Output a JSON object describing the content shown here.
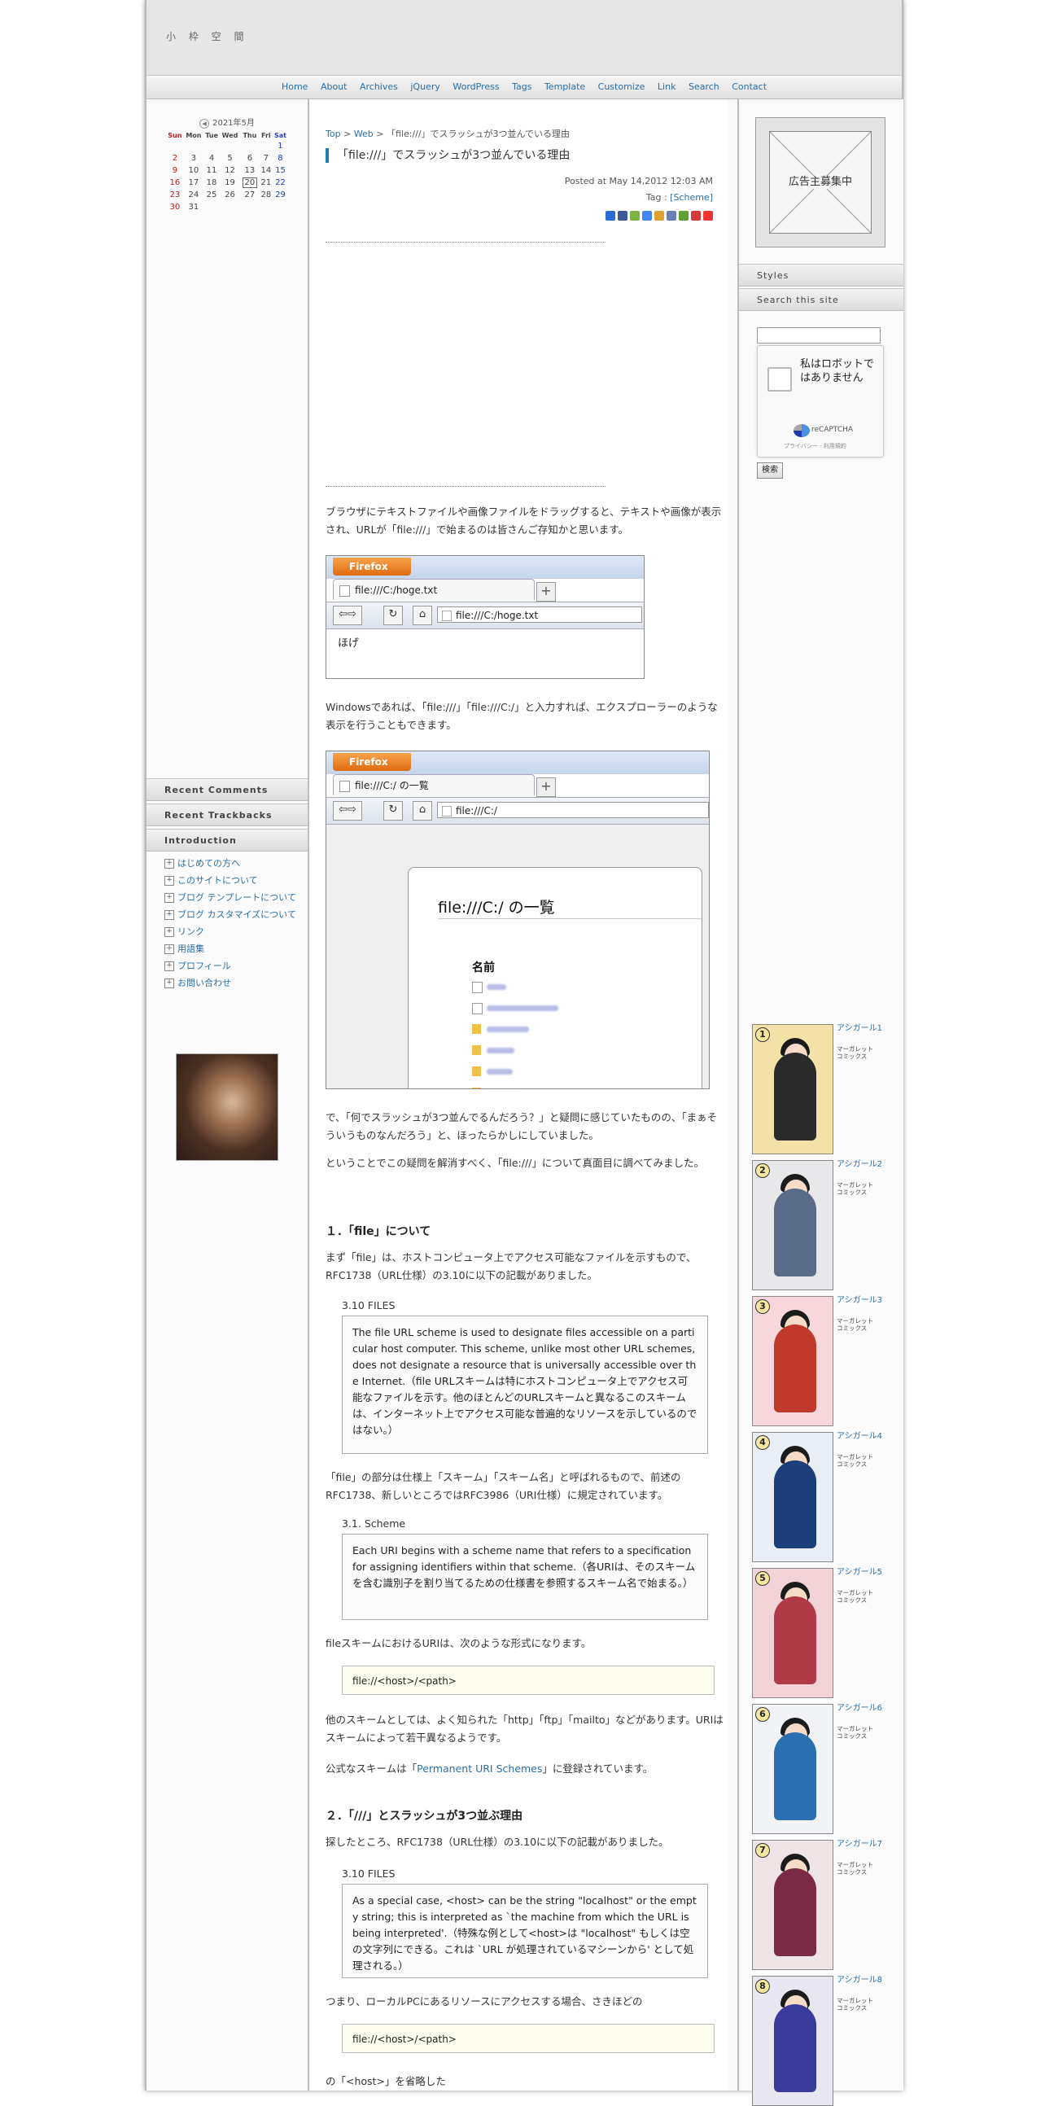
{
  "site": {
    "title": "小 枠 空 間"
  },
  "nav": [
    "Home",
    "About",
    "Archives",
    "jQuery",
    "WordPress",
    "Tags",
    "Template",
    "Customize",
    "Link",
    "Search",
    "Contact"
  ],
  "calendar": {
    "title": "2021年5月",
    "weekdays": [
      "Sun",
      "Mon",
      "Tue",
      "Wed",
      "Thu",
      "Fri",
      "Sat"
    ],
    "weeks": [
      [
        "",
        "",
        "",
        "",
        "",
        "",
        "1"
      ],
      [
        "2",
        "3",
        "4",
        "5",
        "6",
        "7",
        "8"
      ],
      [
        "9",
        "10",
        "11",
        "12",
        "13",
        "14",
        "15"
      ],
      [
        "16",
        "17",
        "18",
        "19",
        "20",
        "21",
        "22"
      ],
      [
        "23",
        "24",
        "25",
        "26",
        "27",
        "28",
        "29"
      ],
      [
        "30",
        "31",
        "",
        "",
        "",
        "",
        ""
      ]
    ],
    "today": "20"
  },
  "left_boxes": [
    "Recent Comments",
    "Recent Trackbacks",
    "Introduction"
  ],
  "intro_links": [
    "はじめての方へ",
    "このサイトについて",
    "ブログ テンプレートについて",
    "ブログ カスタマイズについて",
    "リンク",
    "用語集",
    "プロフィール",
    "お問い合わせ"
  ],
  "post": {
    "breadcrumb": {
      "top": "Top",
      "sep": ">",
      "cat": "Web",
      "current": "「file:///」でスラッシュが3つ並んでいる理由"
    },
    "title": "「file:///」でスラッシュが3つ並んでいる理由",
    "posted": "Posted at May 14,2012 12:03 AM",
    "tag_label": "Tag : ",
    "tag": "[Scheme]",
    "p1": "ブラウザにテキストファイルや画像ファイルをドラッグすると、テキストや画像が表示され、URLが「file:///」で始まるのは皆さんご存知かと思います。",
    "shot1": {
      "menu": "Firefox",
      "tab": "file:///C:/hoge.txt",
      "url": "file:///C:/hoge.txt",
      "body": "ほげ"
    },
    "p2": "Windowsであれば、「file:///」「file:///C:/」と入力すれば、エクスプローラーのような表示を行うこともできます。",
    "shot2": {
      "menu": "Firefox",
      "tab": "file:///C:/ の一覧",
      "url": "file:///C:/",
      "heading": "file:///C:/ の一覧",
      "column": "名前"
    },
    "p3": "で、「何でスラッシュが3つ並んでるんだろう？」と疑問に感じていたものの、「まぁそういうものなんだろう」と、ほったらかしにしていました。",
    "p4": "ということでこの疑問を解消すべく、「file:///」について真面目に調べてみました。",
    "h1": "１．「file」について",
    "p5": "まず「file」は、ホストコンピュータ上でアクセス可能なファイルを示すもので、RFC1738（URL仕様）の3.10に以下の記載がありました。",
    "q1_head": "3.10 FILES",
    "q1": "The file URL scheme is used to designate files accessible on a particular host computer. This scheme, unlike most other URL schemes, does not designate a resource that is universally accessible over the Internet.（file URLスキームは特にホストコンピュータ上でアクセス可能なファイルを示す。他のほとんどのURLスキームと異なるこのスキームは、インターネット上でアクセス可能な普遍的なリソースを示しているのではない。）",
    "p6": "「file」の部分は仕様上「スキーム」「スキーム名」と呼ばれるもので、前述のRFC1738、新しいところではRFC3986（URI仕様）に規定されています。",
    "q2_head": "3.1. Scheme",
    "q2": "Each URI begins with a scheme name that refers to a specification for assigning identifiers within that scheme.（各URIは、そのスキームを含む識別子を割り当てるための仕様書を参照するスキーム名で始まる。）",
    "p7": "fileスキームにおけるURIは、次のような形式になります。",
    "code1": "file://<host>/<path>",
    "p8": "他のスキームとしては、よく知られた「http」「ftp」「mailto」などがあります。URIはスキームによって若干異なるようです。",
    "p9_pre": "公式なスキームは「",
    "p9_link": "Permanent URI Schemes",
    "p9_post": "」に登録されています。",
    "h2": "２．「///」とスラッシュが3つ並ぶ理由",
    "p10": "探したところ、RFC1738（URL仕様）の3.10に以下の記載がありました。",
    "q3_head": "3.10 FILES",
    "q3": "As a special case, <host> can be the string \"localhost\" or the empty string; this is interpreted as `the machine from which the URL is being interpreted'.（特殊な例として<host>は \"localhost\" もしくは空の文字列にできる。これは `URL が処理されているマシーンから' として処理される。）",
    "p11": "つまり、ローカルPCにあるリソースにアクセスする場合、さきほどの",
    "code2": "file://<host>/<path>",
    "p12": "の「<host>」を省略した"
  },
  "right": {
    "ad_text": "広告主募集中",
    "boxes": [
      "Styles",
      "Search this site"
    ],
    "captcha_text": "私はロボットではありません",
    "captcha_brand": "reCAPTCHA",
    "captcha_links": "プライバシー - 利用規約",
    "search_button": "検索",
    "books": [
      {
        "num": "1",
        "title": "アシガール1",
        "sub": "マーガレットコミックス"
      },
      {
        "num": "2",
        "title": "アシガール2",
        "sub": "マーガレットコミックス"
      },
      {
        "num": "3",
        "title": "アシガール3",
        "sub": "マーガレットコミックス"
      },
      {
        "num": "4",
        "title": "アシガール4",
        "sub": "マーガレットコミックス"
      },
      {
        "num": "5",
        "title": "アシガール5",
        "sub": "マーガレットコミックス"
      },
      {
        "num": "6",
        "title": "アシガール6",
        "sub": "マーガレットコミックス"
      },
      {
        "num": "7",
        "title": "アシガール7",
        "sub": "マーガレットコミックス"
      },
      {
        "num": "8",
        "title": "アシガール8",
        "sub": "マーガレットコミックス"
      }
    ]
  },
  "colors": {
    "link": "#2a6ea6",
    "title_accent": "#1f7fa8",
    "sunday": "#c8171e",
    "saturday": "#2040b8"
  }
}
